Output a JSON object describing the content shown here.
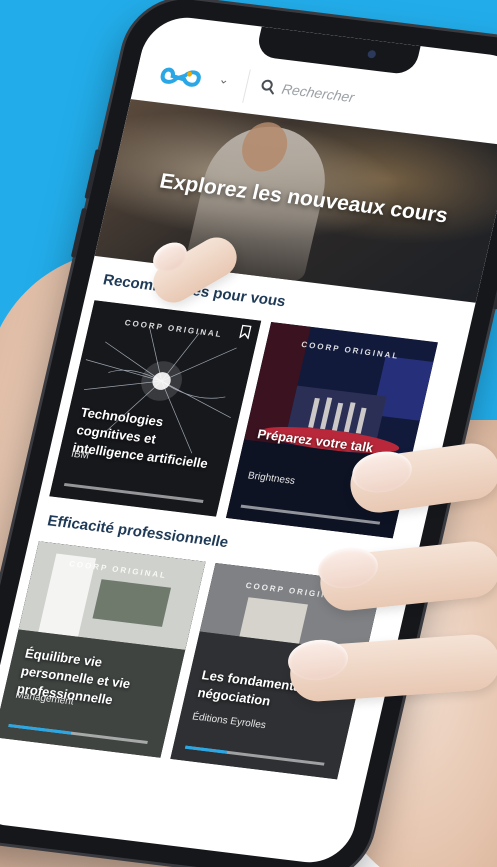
{
  "header": {
    "logo_icon": "infinity-logo-icon",
    "search_placeholder": "Rechercher"
  },
  "hero": {
    "title": "Explorez les nouveaux cours"
  },
  "sections": [
    {
      "title": "Recommandés pour vous",
      "cards": [
        {
          "badge": "COORP ORIGINAL",
          "title": "Technologies cognitives et intelligence artificielle",
          "provider": "IBM",
          "progress": 0.0
        },
        {
          "badge": "COORP ORIGINAL",
          "title": "Préparez votre talk",
          "provider": "Brightness",
          "progress": 0.0
        }
      ]
    },
    {
      "title": "Efficacité professionnelle",
      "cards": [
        {
          "badge": "COORP ORIGINAL",
          "title": "Équilibre vie personnelle et vie professionnelle",
          "provider": "Management",
          "progress": 0.45
        },
        {
          "badge": "COORP ORIGINAL",
          "title": "Les fondamentaux de la négociation",
          "provider": "Éditions Eyrolles",
          "progress": 0.3
        }
      ]
    }
  ],
  "colors": {
    "background": "#22adea",
    "accent": "#2aa7e4",
    "section_title": "#1f3a57"
  }
}
